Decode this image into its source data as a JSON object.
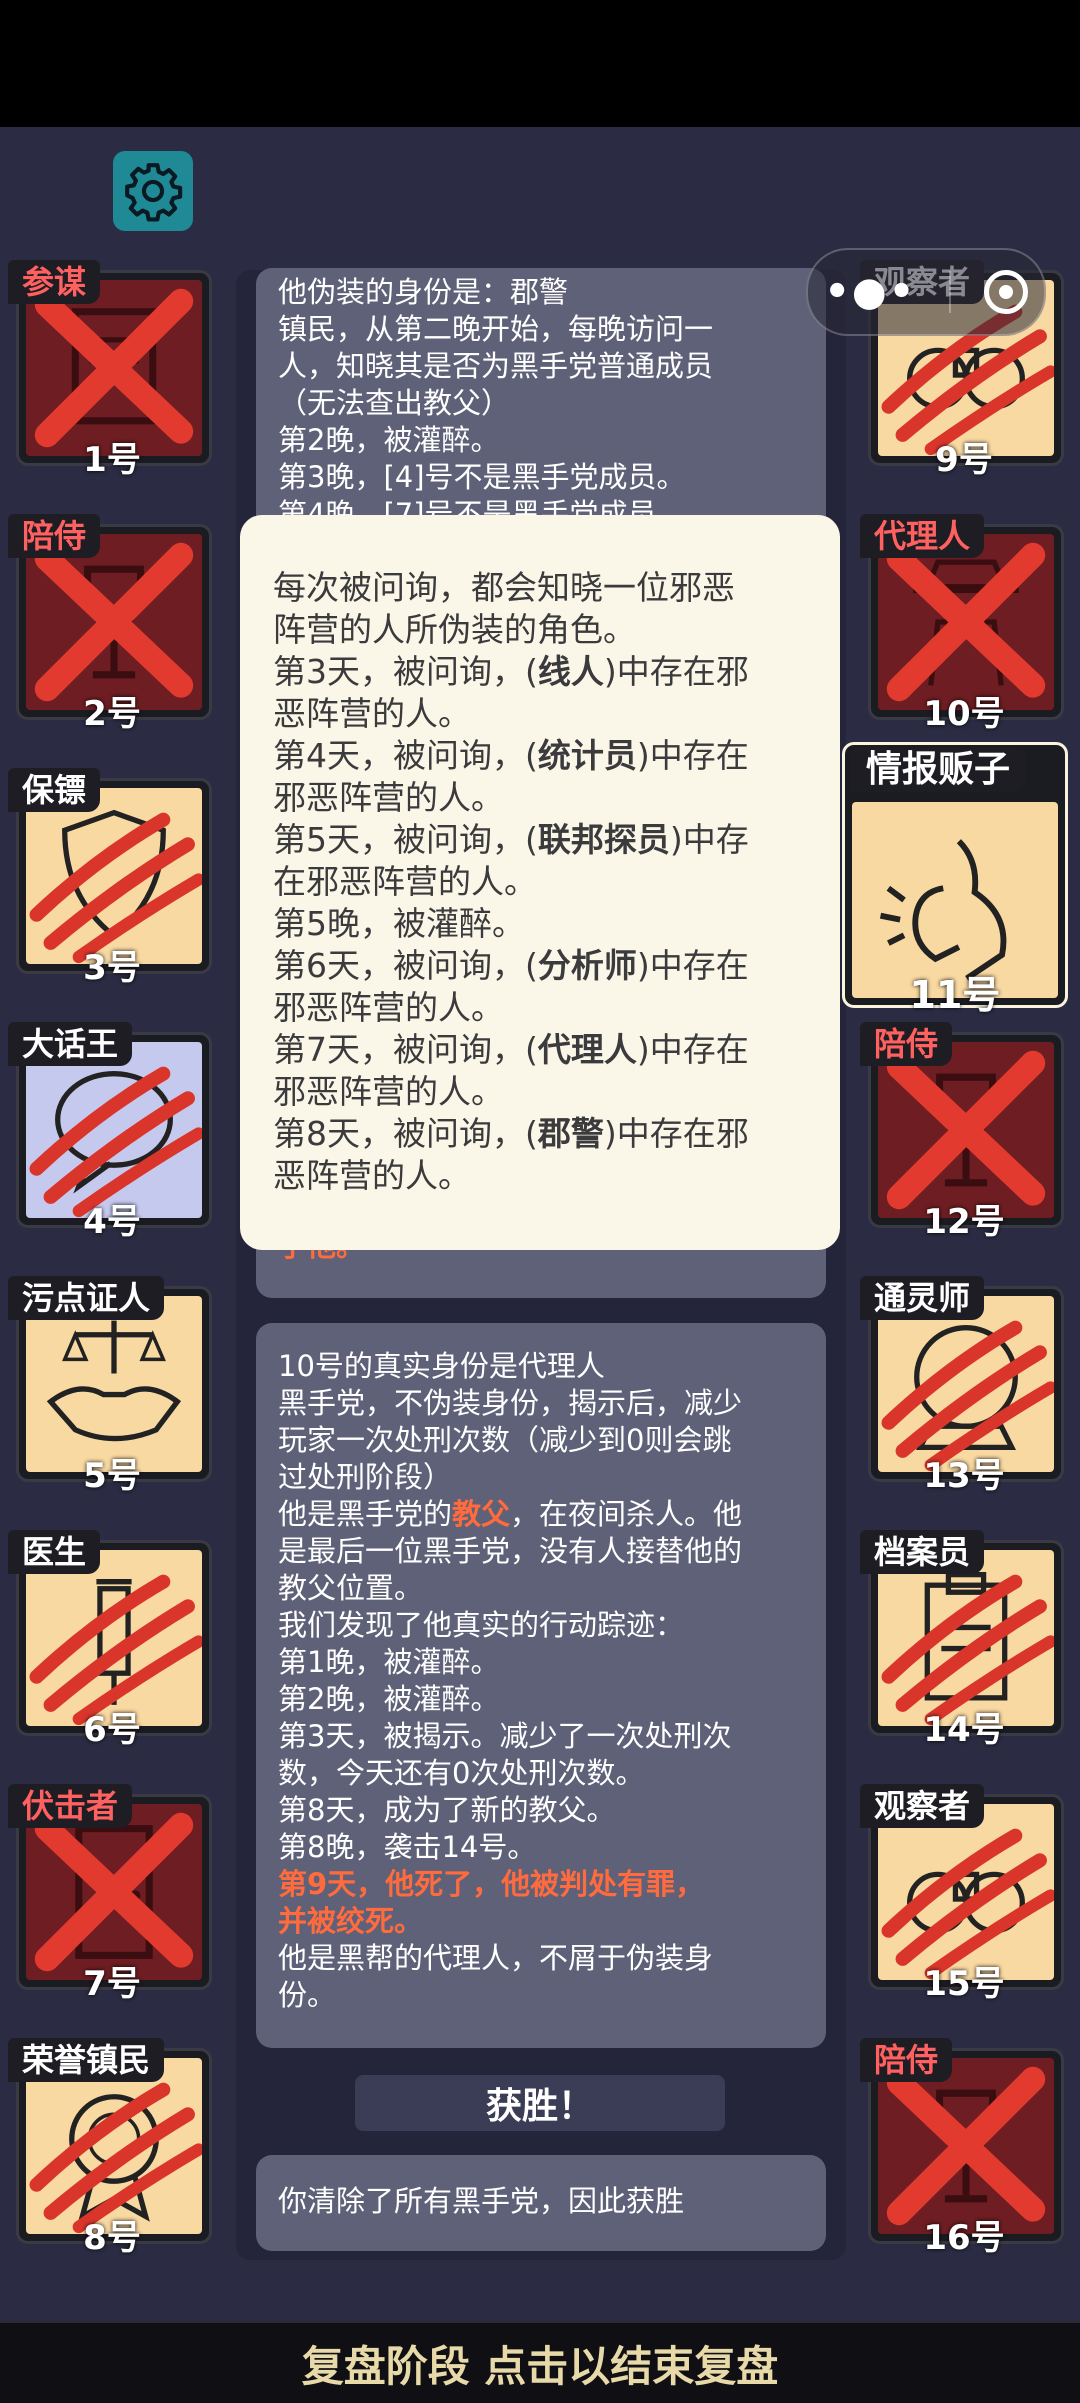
{
  "header": {
    "settings_icon": "gear-icon",
    "capsule_menu_icon": "more-dots-icon",
    "capsule_close_icon": "target-circle-icon"
  },
  "colors": {
    "background": "#2b2c43",
    "accent_red": "#ff6b3d",
    "popup_bg": "#fbf7e8",
    "card_cream": "#f9d9a2",
    "card_dark": "#6e1e22"
  },
  "left_players": [
    {
      "role": "参谋",
      "number": "1号",
      "status": "eliminated-x",
      "icon": "document-icon"
    },
    {
      "role": "陪侍",
      "number": "2号",
      "status": "eliminated-x",
      "icon": "wine-glass-icon"
    },
    {
      "role": "保镖",
      "number": "3号",
      "status": "claw-marked",
      "icon": "shield-icon"
    },
    {
      "role": "大话王",
      "number": "4号",
      "status": "claw-marked",
      "icon": "speech-bubble-icon"
    },
    {
      "role": "污点证人",
      "number": "5号",
      "status": "alive",
      "icon": "scales-handshake-icon"
    },
    {
      "role": "医生",
      "number": "6号",
      "status": "claw-marked",
      "icon": "syringe-icon"
    },
    {
      "role": "伏击者",
      "number": "7号",
      "status": "eliminated-x",
      "icon": "door-icon"
    },
    {
      "role": "荣誉镇民",
      "number": "8号",
      "status": "claw-marked",
      "icon": "medal-icon"
    }
  ],
  "right_players": [
    {
      "role": "观察者",
      "number": "9号",
      "status": "claw-marked",
      "icon": "binoculars-icon"
    },
    {
      "role": "代理人",
      "number": "10号",
      "status": "eliminated-x",
      "icon": "hat-man-icon"
    },
    {
      "role": "情报贩子",
      "number": "11号",
      "status": "highlighted",
      "icon": "whisper-icon"
    },
    {
      "role": "陪侍",
      "number": "12号",
      "status": "eliminated-x",
      "icon": "wine-glass-icon"
    },
    {
      "role": "通灵师",
      "number": "13号",
      "status": "claw-marked",
      "icon": "crystal-ball-icon"
    },
    {
      "role": "档案员",
      "number": "14号",
      "status": "claw-marked",
      "icon": "clipboard-icon"
    },
    {
      "role": "观察者",
      "number": "15号",
      "status": "claw-marked",
      "icon": "binoculars-icon"
    },
    {
      "role": "陪侍",
      "number": "16号",
      "status": "eliminated-x",
      "icon": "wine-glass-icon"
    }
  ],
  "log_card_1": {
    "lines": [
      "他伪装的身份是：郡警",
      "镇民，从第二晚开始，每晚访问一",
      "人，知晓其是否为黑手党普通成员",
      "（无法查出教父）",
      "第2晚，被灌醉。",
      "第3晚，[4]号不是黑手党成员。",
      "第4晚，[7]号不是黑手党成员。"
    ],
    "tail": "了他。"
  },
  "popup": {
    "lines": [
      "每次被问询，都会知晓一位邪恶",
      "阵营的人所伪装的角色。"
    ],
    "entries": [
      {
        "pre": "第3天，被问询，(",
        "role": "线人",
        "post": ")中存在邪",
        "cont": "恶阵营的人。"
      },
      {
        "pre": "第4天，被问询，(",
        "role": "统计员",
        "post": ")中存在",
        "cont": "邪恶阵营的人。"
      },
      {
        "pre": "第5天，被问询，(",
        "role": "联邦探员",
        "post": ")中存",
        "cont": "在邪恶阵营的人。"
      }
    ],
    "night5": "第5晚，被灌醉。",
    "entries2": [
      {
        "pre": "第6天，被问询，(",
        "role": "分析师",
        "post": ")中存在",
        "cont": "邪恶阵营的人。"
      },
      {
        "pre": "第7天，被问询，(",
        "role": "代理人",
        "post": ")中存在",
        "cont": "邪恶阵营的人。"
      },
      {
        "pre": "第8天，被问询，(",
        "role": "郡警",
        "post": ")中存在邪",
        "cont": "恶阵营的人。"
      }
    ]
  },
  "log_card_2": {
    "l1": "10号的真实身份是代理人",
    "l2": "黑手党，不伪装身份，揭示后，减少",
    "l3": "玩家一次处刑次数（减少到0则会跳",
    "l4": "过处刑阶段）",
    "l5_pre": "他是黑手党的",
    "l5_red": "教父",
    "l5_post": "，在夜间杀人。他",
    "l6": "是最后一位黑手党，没有人接替他的",
    "l7": "教父位置。",
    "l8": "我们发现了他真实的行动踪迹：",
    "l9": "第1晚，被灌醉。",
    "l10": "第2晚，被灌醉。",
    "l11": "第3天，被揭示。减少了一次处刑次",
    "l12": "数，今天还有0次处刑次数。",
    "l13": "第8天，成为了新的教父。",
    "l14": "第8晚，袭击14号。",
    "l15": "第9天，他死了，他被判处有罪，",
    "l16": "并被绞死。",
    "l17": "他是黑帮的代理人，不屑于伪装身",
    "l18": "份。"
  },
  "victory_label": "获胜！",
  "log_card_3": {
    "text": "你清除了所有黑手党，因此获胜"
  },
  "bottom_bar": {
    "label": "复盘阶段 点击以结束复盘"
  }
}
